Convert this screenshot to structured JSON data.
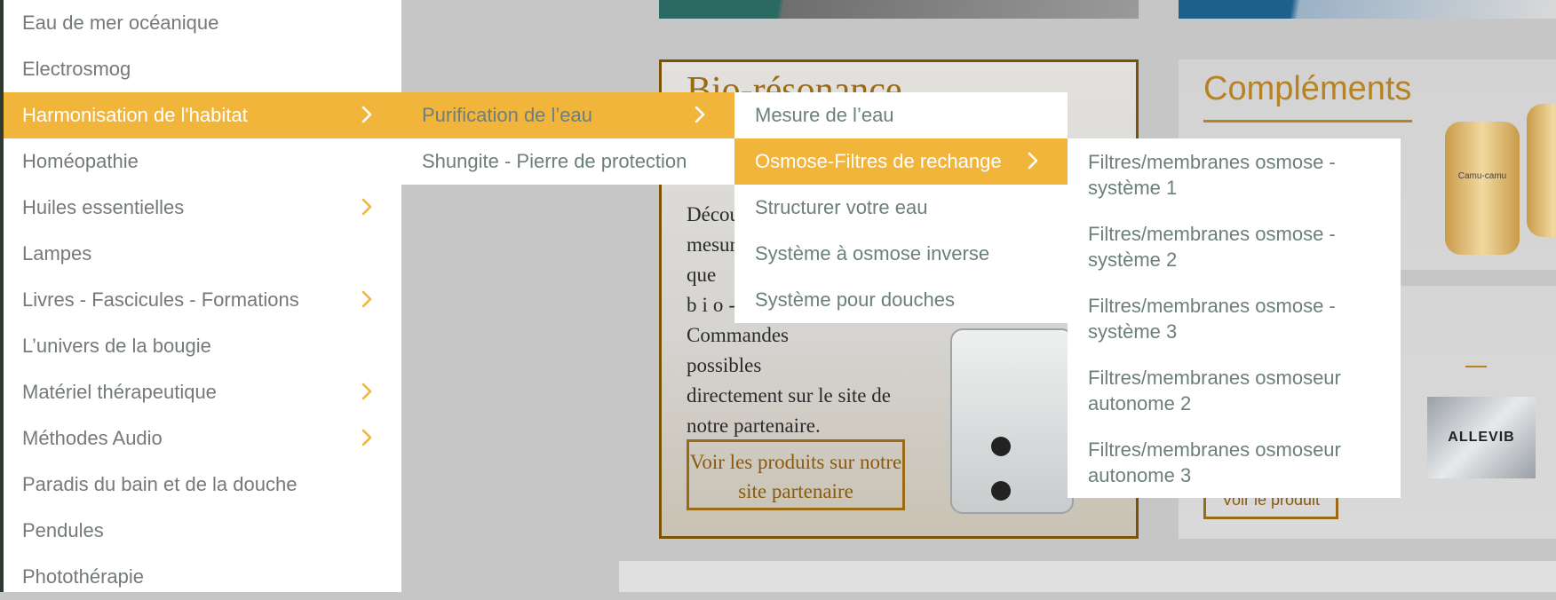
{
  "colors": {
    "accent": "#f2b53c",
    "menu_text": "#6c7f7c",
    "menu_bg": "#ffffff",
    "page_bg": "#c6c6c6"
  },
  "background": {
    "bio_card": {
      "title": "Bio-résonance",
      "text_lines": [
        "Décou",
        "mesur",
        "que",
        "bio-",
        "Commandes possibles",
        "directement sur le site de",
        "notre partenaire."
      ],
      "cta_label": "Voir les produits sur notre site partenaire"
    },
    "complements_card": {
      "title": "Compléments",
      "jar_label": "Camu-camu",
      "brand": "ALLEVIB",
      "cta_label": "Voir le produit"
    }
  },
  "menu_level1": {
    "items": [
      {
        "label": "Eau de mer océanique",
        "has_submenu": false,
        "active": false
      },
      {
        "label": "Electrosmog",
        "has_submenu": false,
        "active": false
      },
      {
        "label": "Harmonisation de l'habitat",
        "has_submenu": true,
        "active": true
      },
      {
        "label": "Homéopathie",
        "has_submenu": false,
        "active": false
      },
      {
        "label": "Huiles essentielles",
        "has_submenu": true,
        "active": false
      },
      {
        "label": "Lampes",
        "has_submenu": false,
        "active": false
      },
      {
        "label": "Livres - Fascicules - Formations",
        "has_submenu": true,
        "active": false
      },
      {
        "label": "L’univers de la bougie",
        "has_submenu": false,
        "active": false
      },
      {
        "label": "Matériel thérapeutique",
        "has_submenu": true,
        "active": false
      },
      {
        "label": "Méthodes Audio",
        "has_submenu": true,
        "active": false
      },
      {
        "label": "Paradis du bain et de la douche",
        "has_submenu": false,
        "active": false
      },
      {
        "label": "Pendules",
        "has_submenu": false,
        "active": false
      },
      {
        "label": "Photothérapie",
        "has_submenu": false,
        "active": false
      }
    ]
  },
  "menu_level2": {
    "items": [
      {
        "label": "Purification de l’eau",
        "has_submenu": true,
        "active": true
      },
      {
        "label": "Shungite - Pierre de protection",
        "has_submenu": false,
        "active": false
      }
    ]
  },
  "menu_level3": {
    "items": [
      {
        "label": "Mesure de l’eau",
        "has_submenu": false,
        "active": false
      },
      {
        "label": "Osmose-Filtres de rechange",
        "has_submenu": true,
        "active": true
      },
      {
        "label": "Structurer votre eau",
        "has_submenu": false,
        "active": false
      },
      {
        "label": "Système à osmose inverse",
        "has_submenu": false,
        "active": false
      },
      {
        "label": "Système pour douches",
        "has_submenu": false,
        "active": false
      }
    ]
  },
  "menu_level4": {
    "items": [
      {
        "label": "Filtres/membranes osmose - système 1"
      },
      {
        "label": "Filtres/membranes osmose - système 2"
      },
      {
        "label": "Filtres/membranes osmose - système 3"
      },
      {
        "label": "Filtres/membranes osmoseur autonome 2"
      },
      {
        "label": "Filtres/membranes osmoseur autonome 3"
      }
    ]
  }
}
